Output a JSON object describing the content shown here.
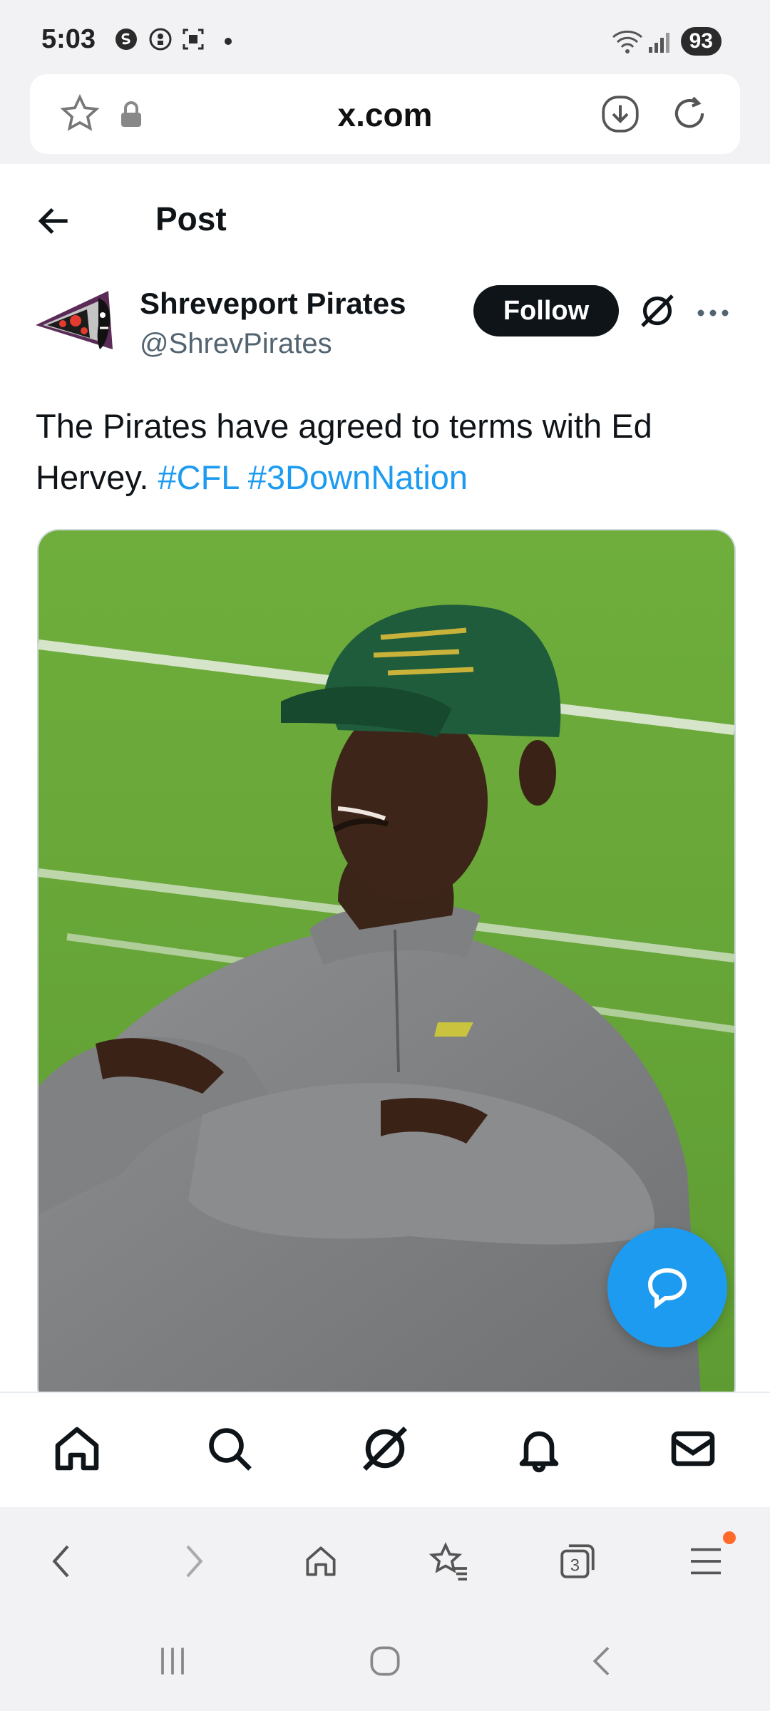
{
  "status_bar": {
    "time": "5:03",
    "battery": "93",
    "icons": [
      "circle-s-icon",
      "circle-gear-icon",
      "scan-icon",
      "dot-icon",
      "wifi-icon",
      "signal-icon"
    ]
  },
  "browser": {
    "url": "x.com",
    "address_icons": [
      "star-icon",
      "lock-icon",
      "download-icon",
      "refresh-icon"
    ],
    "tab_count": "3"
  },
  "header": {
    "title": "Post"
  },
  "tweet": {
    "display_name": "Shreveport Pirates",
    "handle": "@ShrevPirates",
    "follow_label": "Follow",
    "text_before": "The Pirates have agreed to terms with Ed Hervey. ",
    "hashtag1": "#CFL",
    "hashtag2": "#3DownNation"
  },
  "nav": {
    "tabs": [
      "home-icon",
      "search-icon",
      "grok-icon",
      "bell-icon",
      "mail-icon"
    ]
  },
  "colors": {
    "accent": "#1d9bf0",
    "follow_bg": "#0f1419",
    "field_green": "#6fa93a",
    "badge_orange": "#ff6a2b"
  }
}
